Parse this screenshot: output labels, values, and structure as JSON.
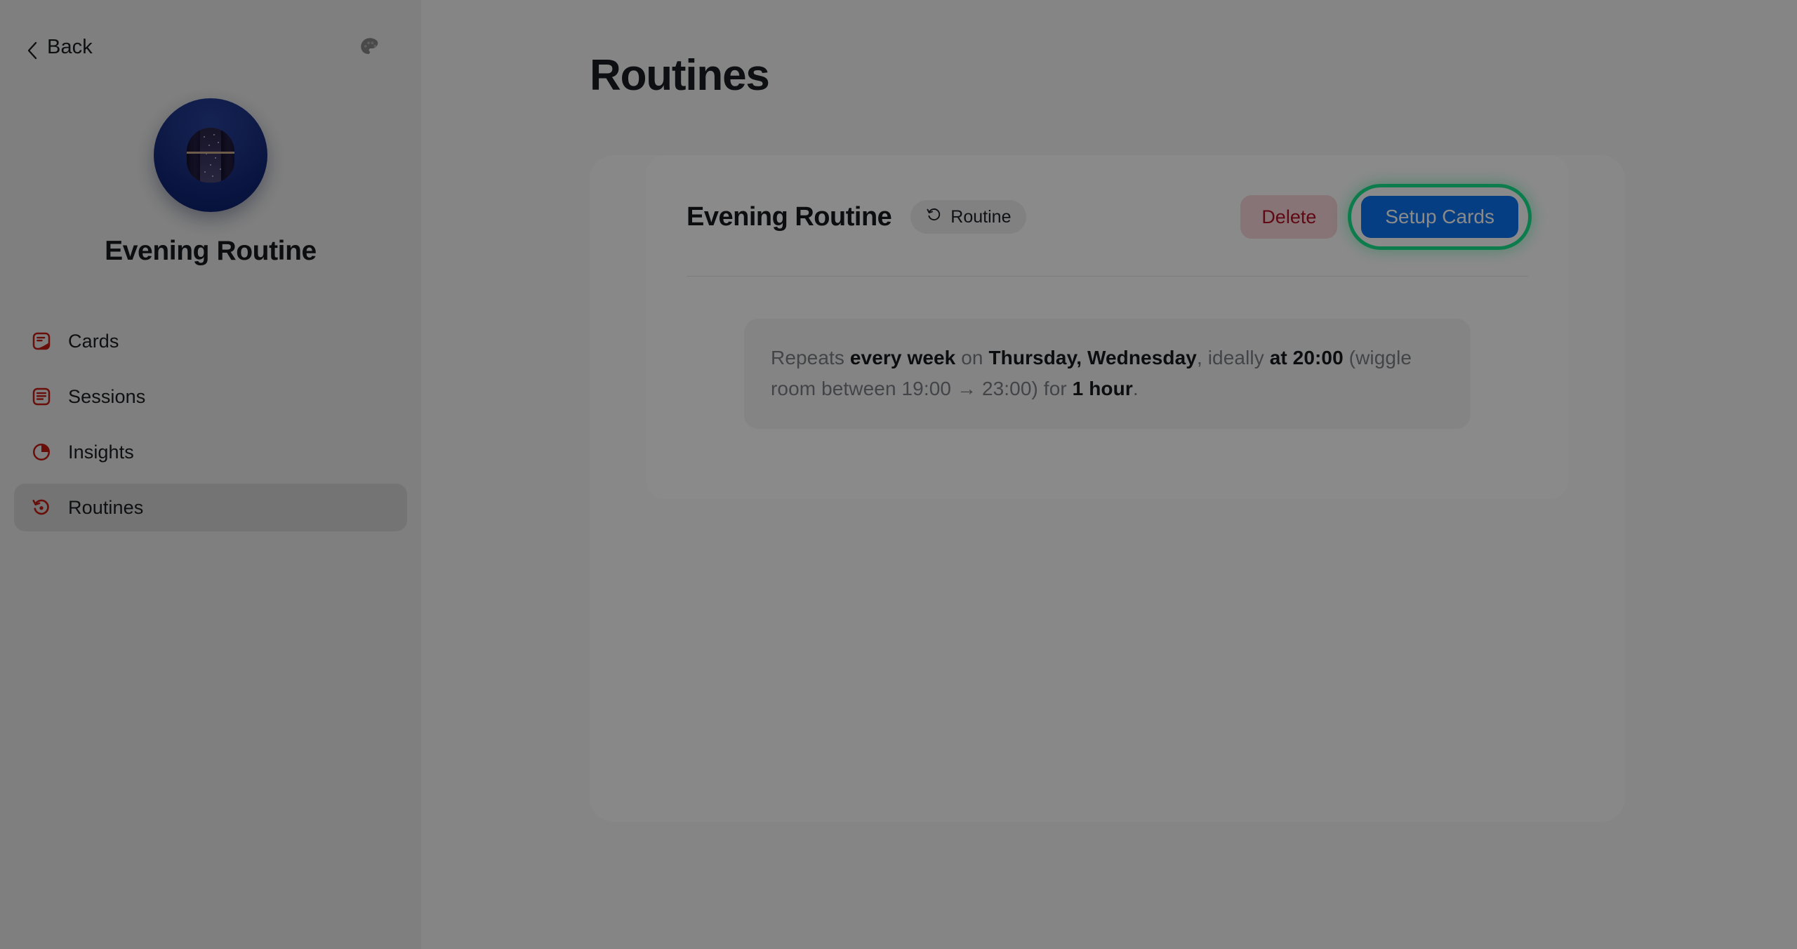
{
  "sidebar": {
    "back_label": "Back",
    "palette_icon": "palette-icon",
    "avatar_icon": "night-window-avatar",
    "title": "Evening Routine",
    "items": [
      {
        "label": "Cards",
        "icon": "card-note-icon",
        "active": false
      },
      {
        "label": "Sessions",
        "icon": "session-note-icon",
        "active": false
      },
      {
        "label": "Insights",
        "icon": "pie-chart-icon",
        "active": false
      },
      {
        "label": "Routines",
        "icon": "history-restore-icon",
        "active": true
      }
    ]
  },
  "main": {
    "page_title": "Routines",
    "routine_card": {
      "title": "Evening Routine",
      "badge": {
        "label": "Routine",
        "icon": "rotate-ccw-icon"
      },
      "delete_label": "Delete",
      "setup_label": "Setup Cards",
      "schedule": {
        "s1": "Repeats ",
        "b1": "every week",
        "s2": " on ",
        "b2": "Thursday, Wednesday",
        "s3": ", ideally ",
        "b3": "at 20:00",
        "s4": " (wiggle room between 19:00 → 23:00) for ",
        "b4": "1 hour",
        "s5": "."
      }
    }
  },
  "colors": {
    "accent_blue": "#0a74f0",
    "danger_red": "#b11226",
    "danger_bg": "#f8d7da",
    "icon_red": "#c21a12",
    "highlight_green": "#19e68c",
    "avatar_blue": "#1d3284"
  }
}
